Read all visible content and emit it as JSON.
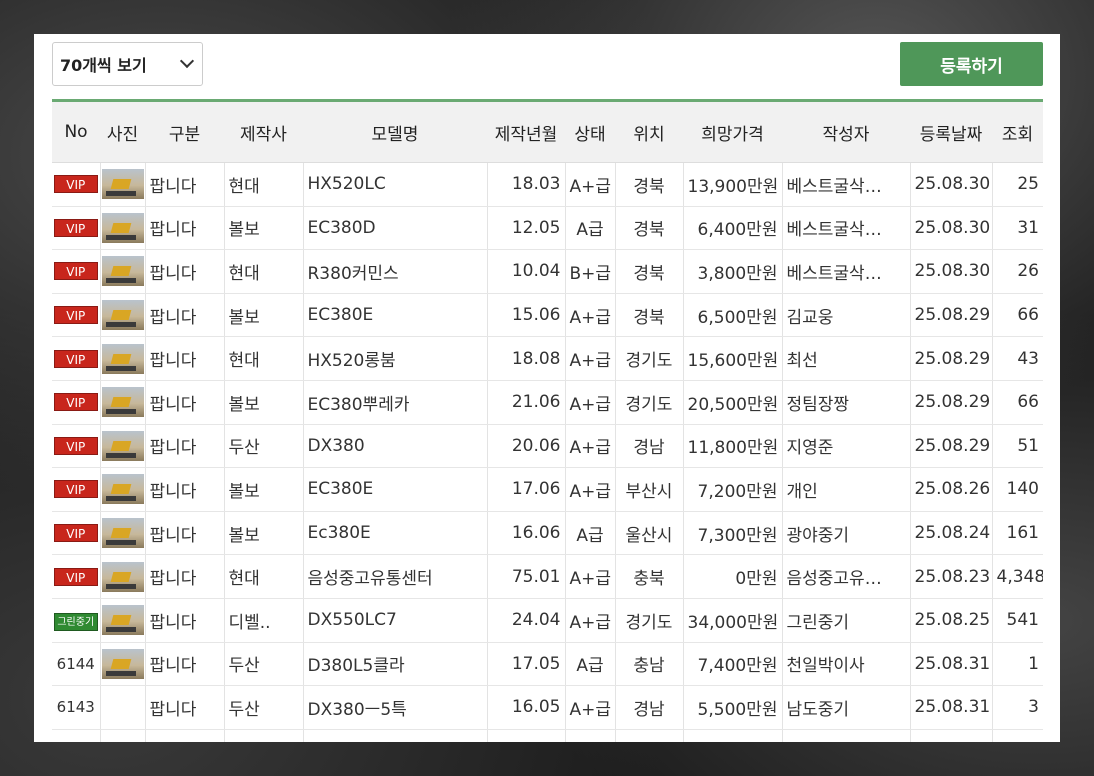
{
  "toolbar": {
    "page_size": "70개씩 보기",
    "register_label": "등록하기"
  },
  "columns": [
    "No",
    "사진",
    "구분",
    "제작사",
    "모델명",
    "제작년월",
    "상태",
    "위치",
    "희망가격",
    "작성자",
    "등록날짜",
    "조회"
  ],
  "rows": [
    {
      "no": "",
      "badge": "VIP",
      "photo": true,
      "type": "팝니다",
      "maker": "현대",
      "model": "HX520LC",
      "year": "18.03",
      "grade": "A+급",
      "loc": "경북",
      "price": "13,900만원",
      "author": "베스트굴삭…",
      "date": "25.08.30",
      "views": "25"
    },
    {
      "no": "",
      "badge": "VIP",
      "photo": true,
      "type": "팝니다",
      "maker": "볼보",
      "model": "EC380D",
      "year": "12.05",
      "grade": "A급",
      "loc": "경북",
      "price": "6,400만원",
      "author": "베스트굴삭…",
      "date": "25.08.30",
      "views": "31"
    },
    {
      "no": "",
      "badge": "VIP",
      "photo": true,
      "type": "팝니다",
      "maker": "현대",
      "model": "R380커민스",
      "year": "10.04",
      "grade": "B+급",
      "loc": "경북",
      "price": "3,800만원",
      "author": "베스트굴삭…",
      "date": "25.08.30",
      "views": "26"
    },
    {
      "no": "",
      "badge": "VIP",
      "photo": true,
      "type": "팝니다",
      "maker": "볼보",
      "model": "EC380E",
      "year": "15.06",
      "grade": "A+급",
      "loc": "경북",
      "price": "6,500만원",
      "author": "김교웅",
      "date": "25.08.29",
      "views": "66"
    },
    {
      "no": "",
      "badge": "VIP",
      "photo": true,
      "type": "팝니다",
      "maker": "현대",
      "model": "HX520롱붐",
      "year": "18.08",
      "grade": "A+급",
      "loc": "경기도",
      "price": "15,600만원",
      "author": "최선",
      "date": "25.08.29",
      "views": "43"
    },
    {
      "no": "",
      "badge": "VIP",
      "photo": true,
      "type": "팝니다",
      "maker": "볼보",
      "model": "EC380뿌레카",
      "year": "21.06",
      "grade": "A+급",
      "loc": "경기도",
      "price": "20,500만원",
      "author": "정팀장짱",
      "date": "25.08.29",
      "views": "66"
    },
    {
      "no": "",
      "badge": "VIP",
      "photo": true,
      "type": "팝니다",
      "maker": "두산",
      "model": "DX380",
      "year": "20.06",
      "grade": "A+급",
      "loc": "경남",
      "price": "11,800만원",
      "author": "지영준",
      "date": "25.08.29",
      "views": "51"
    },
    {
      "no": "",
      "badge": "VIP",
      "photo": true,
      "type": "팝니다",
      "maker": "볼보",
      "model": "EC380E",
      "year": "17.06",
      "grade": "A+급",
      "loc": "부산시",
      "price": "7,200만원",
      "author": "개인",
      "date": "25.08.26",
      "views": "140"
    },
    {
      "no": "",
      "badge": "VIP",
      "photo": true,
      "type": "팝니다",
      "maker": "볼보",
      "model": "Ec380E",
      "year": "16.06",
      "grade": "A급",
      "loc": "울산시",
      "price": "7,300만원",
      "author": "광야중기",
      "date": "25.08.24",
      "views": "161"
    },
    {
      "no": "",
      "badge": "VIP",
      "photo": true,
      "type": "팝니다",
      "maker": "현대",
      "model": "음성중고유통센터",
      "year": "75.01",
      "grade": "A+급",
      "loc": "충북",
      "price": "0만원",
      "author": "음성중고유…",
      "date": "25.08.23",
      "views": "4,348"
    },
    {
      "no": "",
      "badge": "그린중기",
      "photo": true,
      "type": "팝니다",
      "maker": "디벨..",
      "model": "DX550LC7",
      "year": "24.04",
      "grade": "A+급",
      "loc": "경기도",
      "price": "34,000만원",
      "author": "그린중기",
      "date": "25.08.25",
      "views": "541"
    },
    {
      "no": "6144",
      "badge": "",
      "photo": true,
      "type": "팝니다",
      "maker": "두산",
      "model": "D380L5클라",
      "year": "17.05",
      "grade": "A급",
      "loc": "충남",
      "price": "7,400만원",
      "author": "천일박이사",
      "date": "25.08.31",
      "views": "1"
    },
    {
      "no": "6143",
      "badge": "",
      "photo": false,
      "type": "팝니다",
      "maker": "두산",
      "model": "DX380ㅡ5특",
      "year": "16.05",
      "grade": "A+급",
      "loc": "경남",
      "price": "5,500만원",
      "author": "남도중기",
      "date": "25.08.31",
      "views": "3"
    }
  ]
}
